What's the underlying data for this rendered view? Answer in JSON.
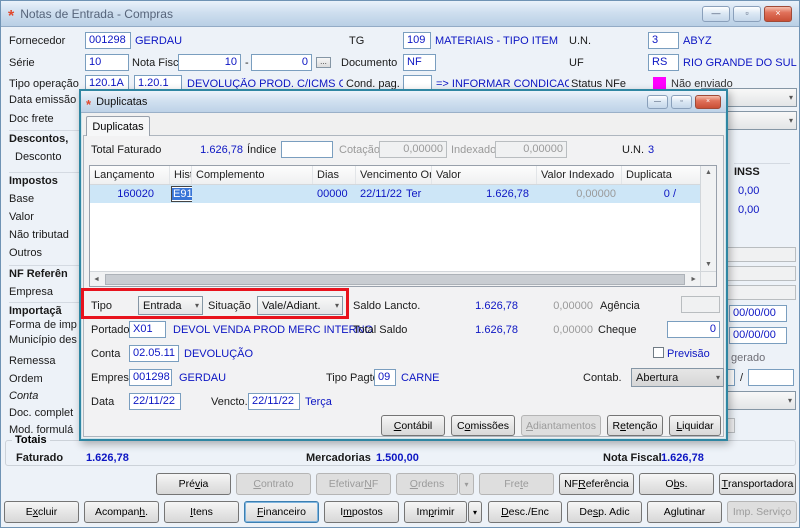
{
  "icons": {
    "app": "*",
    "minimize": "—",
    "maximize": "▫",
    "close": "×",
    "dropdown": "▾",
    "scroll_up": "▲",
    "scroll_down": "▼",
    "scroll_left": "◄",
    "scroll_right": "►"
  },
  "colors": {
    "value_blue": "#0c15c3",
    "status_nfe": "#ff00ff",
    "annotation_red": "#e8131d",
    "row_selection": "#cde6f7"
  },
  "window": {
    "title": "Notas de Entrada - Compras"
  },
  "form": {
    "fornecedor": {
      "label": "Fornecedor",
      "code": "001298",
      "name": "GERDAU"
    },
    "tg": {
      "label": "TG",
      "code": "109",
      "name": "MATERIAIS - TIPO ITEM"
    },
    "un": {
      "label": "U.N.",
      "code": "3",
      "name": "ABYZ"
    },
    "serie": {
      "label": "Série",
      "value": "10"
    },
    "nota_fiscal": {
      "label": "Nota Fiscal",
      "value": "10",
      "separator": "-",
      "value2": "0",
      "browse": "..."
    },
    "documento": {
      "label": "Documento",
      "value": "NF"
    },
    "uf": {
      "label": "UF",
      "code": "RS",
      "name": "RIO GRANDE DO SUL"
    },
    "tipo_operacao": {
      "label": "Tipo operação",
      "code": "120.1A",
      "code2": "1.20.1",
      "desc": "DEVOLUÇÃO  PROD. C/ICMS C/IPI S"
    },
    "cond_pag": {
      "label": "Cond. pag.",
      "value": "",
      "hint": "=> INFORMAR CONDICAO DE PA"
    },
    "status_nfe": {
      "label": "Status NFe",
      "value": "Não enviado"
    },
    "data_emissao": {
      "label": "Data emissão"
    }
  },
  "left_labels": [
    {
      "text": "Doc frete"
    },
    {
      "text": "Descontos,"
    },
    {
      "text": "Desconto"
    },
    {
      "text": "Impostos"
    },
    {
      "text": "Base"
    },
    {
      "text": "Valor"
    },
    {
      "text": "Não tributad"
    },
    {
      "text": "Outros"
    },
    {
      "text": "NF Referên"
    },
    {
      "text": "Empresa"
    },
    {
      "text": "Importaçã"
    },
    {
      "text": "Forma de imp"
    },
    {
      "text": "Município des"
    },
    {
      "text": "Remessa"
    },
    {
      "text": "Ordem"
    },
    {
      "text": "Conta"
    },
    {
      "text": "Doc. complet"
    },
    {
      "text": "Mod. formulá"
    }
  ],
  "right_panel": {
    "inss_title": "INSS",
    "inss_value1": "0,00",
    "inss_value2": "0,00",
    "date1": "00/00/00",
    "date2": "00/00/00",
    "gerado": "gerado",
    "slash": "/"
  },
  "totais": {
    "title": "Totais",
    "faturado_label": "Faturado",
    "faturado_value": "1.626,78",
    "mercadorias_label": "Mercadorias",
    "mercadorias_value": "1.500,00",
    "nota_fiscal_label": "Nota Fiscal",
    "nota_fiscal_value": "1.626,78"
  },
  "toolbar_mid": {
    "previa": "Pré&via",
    "contrato": "&Contrato",
    "efetivar_nf": "Efetivar &NF",
    "ordens": "&Ordens",
    "frete": "Fre&te",
    "nf_referencia": "NF &Referência",
    "obs": "O&bs.",
    "transportadora": "&Transportadora"
  },
  "toolbar_bottom": {
    "excluir": "E&xcluir",
    "acompanh": "Acompan&h.",
    "itens": "&Itens",
    "financeiro": "&Financeiro",
    "impostos": "I&mpostos",
    "imprimir": "Im&primir",
    "desc_enc": "&Desc./Enc",
    "desp_adic": "De&sp. Adic",
    "aglutinar": "A&glutinar",
    "imp_servico": "Imp. Serviço"
  },
  "dialog": {
    "title": "Duplicatas",
    "tab": "Duplicatas",
    "summary": {
      "total_faturado_label": "Total Faturado",
      "total_faturado_value": "1.626,78",
      "indice_label": "Índice",
      "indice_value": "",
      "cotacao_label": "Cotação",
      "cotacao_value": "0,00000",
      "indexado_label": "Indexado",
      "indexado_value": "0,00000",
      "un_label": "U.N.",
      "un_value": "3"
    },
    "table": {
      "columns": [
        "Lançamento",
        "Hist.",
        "Complemento",
        "Dias",
        "Vencimento Orig.",
        "Valor",
        "Valor Indexado",
        "Duplicata"
      ],
      "row": {
        "lancamento": "160020",
        "hist": "E91",
        "complemento": "",
        "dias": "00000",
        "vencimento": "22/11/22",
        "dia_semana": "Ter",
        "valor": "1.626,78",
        "valor_indexado": "0,00000",
        "duplicata": "0 /"
      }
    },
    "fields": {
      "tipo_label": "Tipo",
      "tipo_value": "Entrada",
      "situacao_label": "Situação",
      "situacao_value": "Vale/Adiant.",
      "saldo_lancto_label": "Saldo Lancto.",
      "saldo_lancto_value": "1.626,78",
      "saldo_lancto_indexado": "0,00000",
      "agencia_label": "Agência",
      "portador_label": "Portador",
      "portador_code": "X01",
      "portador_name": "DEVOL VENDA PROD MERC INTERNO",
      "total_saldo_label": "Total Saldo",
      "total_saldo_value": "1.626,78",
      "total_saldo_indexado": "0,00000",
      "cheque_label": "Cheque",
      "cheque_value": "0",
      "conta_label": "Conta",
      "conta_code": "02.05.11",
      "conta_name": "DEVOLUÇÃO",
      "previsao_label": "Previsão",
      "empresa_label": "Empresa",
      "empresa_code": "001298",
      "empresa_name": "GERDAU",
      "tipo_pagto_label": "Tipo Pagto.",
      "tipo_pagto_code": "09",
      "tipo_pagto_name": "CARNE",
      "contab_label": "Contab.",
      "contab_value": "Abertura",
      "data_label": "Data",
      "data_value": "22/11/22",
      "vencto_label": "Vencto.",
      "vencto_value": "22/11/22",
      "vencto_dia": "Terça"
    },
    "buttons": {
      "contabil": "&Contábil",
      "comissoes": "C&omissões",
      "adiantamentos": "&Adiantamentos",
      "retencao": "R&etenção",
      "liquidar": "&Liquidar"
    }
  }
}
